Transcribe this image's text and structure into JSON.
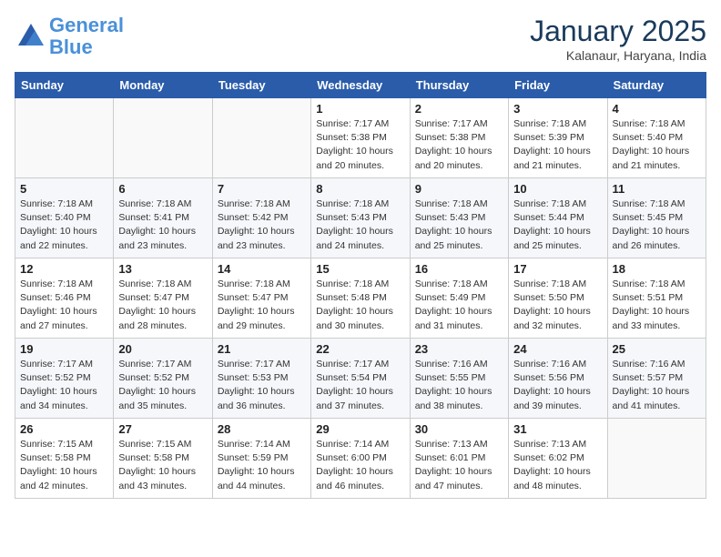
{
  "logo": {
    "line1": "General",
    "line2": "Blue"
  },
  "title": "January 2025",
  "location": "Kalanaur, Haryana, India",
  "weekdays": [
    "Sunday",
    "Monday",
    "Tuesday",
    "Wednesday",
    "Thursday",
    "Friday",
    "Saturday"
  ],
  "weeks": [
    [
      {
        "day": "",
        "info": ""
      },
      {
        "day": "",
        "info": ""
      },
      {
        "day": "",
        "info": ""
      },
      {
        "day": "1",
        "info": "Sunrise: 7:17 AM\nSunset: 5:38 PM\nDaylight: 10 hours\nand 20 minutes."
      },
      {
        "day": "2",
        "info": "Sunrise: 7:17 AM\nSunset: 5:38 PM\nDaylight: 10 hours\nand 20 minutes."
      },
      {
        "day": "3",
        "info": "Sunrise: 7:18 AM\nSunset: 5:39 PM\nDaylight: 10 hours\nand 21 minutes."
      },
      {
        "day": "4",
        "info": "Sunrise: 7:18 AM\nSunset: 5:40 PM\nDaylight: 10 hours\nand 21 minutes."
      }
    ],
    [
      {
        "day": "5",
        "info": "Sunrise: 7:18 AM\nSunset: 5:40 PM\nDaylight: 10 hours\nand 22 minutes."
      },
      {
        "day": "6",
        "info": "Sunrise: 7:18 AM\nSunset: 5:41 PM\nDaylight: 10 hours\nand 23 minutes."
      },
      {
        "day": "7",
        "info": "Sunrise: 7:18 AM\nSunset: 5:42 PM\nDaylight: 10 hours\nand 23 minutes."
      },
      {
        "day": "8",
        "info": "Sunrise: 7:18 AM\nSunset: 5:43 PM\nDaylight: 10 hours\nand 24 minutes."
      },
      {
        "day": "9",
        "info": "Sunrise: 7:18 AM\nSunset: 5:43 PM\nDaylight: 10 hours\nand 25 minutes."
      },
      {
        "day": "10",
        "info": "Sunrise: 7:18 AM\nSunset: 5:44 PM\nDaylight: 10 hours\nand 25 minutes."
      },
      {
        "day": "11",
        "info": "Sunrise: 7:18 AM\nSunset: 5:45 PM\nDaylight: 10 hours\nand 26 minutes."
      }
    ],
    [
      {
        "day": "12",
        "info": "Sunrise: 7:18 AM\nSunset: 5:46 PM\nDaylight: 10 hours\nand 27 minutes."
      },
      {
        "day": "13",
        "info": "Sunrise: 7:18 AM\nSunset: 5:47 PM\nDaylight: 10 hours\nand 28 minutes."
      },
      {
        "day": "14",
        "info": "Sunrise: 7:18 AM\nSunset: 5:47 PM\nDaylight: 10 hours\nand 29 minutes."
      },
      {
        "day": "15",
        "info": "Sunrise: 7:18 AM\nSunset: 5:48 PM\nDaylight: 10 hours\nand 30 minutes."
      },
      {
        "day": "16",
        "info": "Sunrise: 7:18 AM\nSunset: 5:49 PM\nDaylight: 10 hours\nand 31 minutes."
      },
      {
        "day": "17",
        "info": "Sunrise: 7:18 AM\nSunset: 5:50 PM\nDaylight: 10 hours\nand 32 minutes."
      },
      {
        "day": "18",
        "info": "Sunrise: 7:18 AM\nSunset: 5:51 PM\nDaylight: 10 hours\nand 33 minutes."
      }
    ],
    [
      {
        "day": "19",
        "info": "Sunrise: 7:17 AM\nSunset: 5:52 PM\nDaylight: 10 hours\nand 34 minutes."
      },
      {
        "day": "20",
        "info": "Sunrise: 7:17 AM\nSunset: 5:52 PM\nDaylight: 10 hours\nand 35 minutes."
      },
      {
        "day": "21",
        "info": "Sunrise: 7:17 AM\nSunset: 5:53 PM\nDaylight: 10 hours\nand 36 minutes."
      },
      {
        "day": "22",
        "info": "Sunrise: 7:17 AM\nSunset: 5:54 PM\nDaylight: 10 hours\nand 37 minutes."
      },
      {
        "day": "23",
        "info": "Sunrise: 7:16 AM\nSunset: 5:55 PM\nDaylight: 10 hours\nand 38 minutes."
      },
      {
        "day": "24",
        "info": "Sunrise: 7:16 AM\nSunset: 5:56 PM\nDaylight: 10 hours\nand 39 minutes."
      },
      {
        "day": "25",
        "info": "Sunrise: 7:16 AM\nSunset: 5:57 PM\nDaylight: 10 hours\nand 41 minutes."
      }
    ],
    [
      {
        "day": "26",
        "info": "Sunrise: 7:15 AM\nSunset: 5:58 PM\nDaylight: 10 hours\nand 42 minutes."
      },
      {
        "day": "27",
        "info": "Sunrise: 7:15 AM\nSunset: 5:58 PM\nDaylight: 10 hours\nand 43 minutes."
      },
      {
        "day": "28",
        "info": "Sunrise: 7:14 AM\nSunset: 5:59 PM\nDaylight: 10 hours\nand 44 minutes."
      },
      {
        "day": "29",
        "info": "Sunrise: 7:14 AM\nSunset: 6:00 PM\nDaylight: 10 hours\nand 46 minutes."
      },
      {
        "day": "30",
        "info": "Sunrise: 7:13 AM\nSunset: 6:01 PM\nDaylight: 10 hours\nand 47 minutes."
      },
      {
        "day": "31",
        "info": "Sunrise: 7:13 AM\nSunset: 6:02 PM\nDaylight: 10 hours\nand 48 minutes."
      },
      {
        "day": "",
        "info": ""
      }
    ]
  ]
}
